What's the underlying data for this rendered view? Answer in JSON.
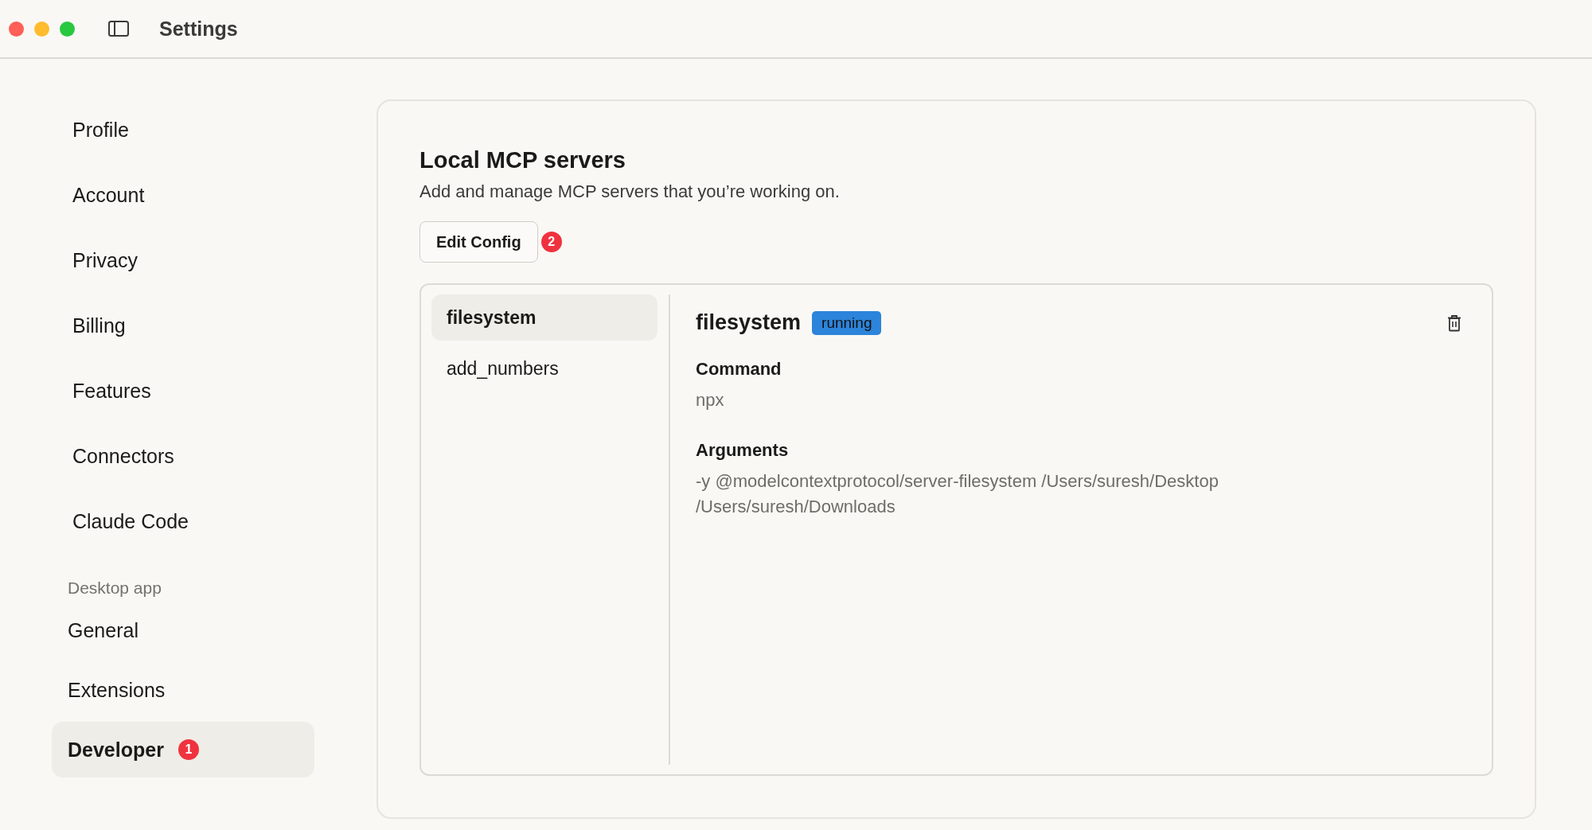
{
  "window": {
    "title": "Settings"
  },
  "sidebar": {
    "groups": [
      {
        "items": [
          {
            "label": "Profile",
            "selected": false
          },
          {
            "label": "Account",
            "selected": false
          },
          {
            "label": "Privacy",
            "selected": false
          },
          {
            "label": "Billing",
            "selected": false
          },
          {
            "label": "Features",
            "selected": false
          },
          {
            "label": "Connectors",
            "selected": false
          },
          {
            "label": "Claude Code",
            "selected": false
          }
        ]
      },
      {
        "heading": "Desktop app",
        "items": [
          {
            "label": "General",
            "selected": false
          },
          {
            "label": "Extensions",
            "selected": false
          },
          {
            "label": "Developer",
            "selected": true,
            "badge": "1"
          }
        ]
      }
    ]
  },
  "main": {
    "title": "Local MCP servers",
    "description": "Add and manage MCP servers that you’re working on.",
    "edit_button": {
      "label": "Edit Config",
      "badge": "2"
    },
    "servers": [
      {
        "name": "filesystem",
        "selected": true
      },
      {
        "name": "add_numbers",
        "selected": false
      }
    ],
    "detail": {
      "name": "filesystem",
      "status": "running",
      "fields": [
        {
          "label": "Command",
          "value": "npx"
        },
        {
          "label": "Arguments",
          "value": "-y @modelcontextprotocol/server-filesystem /Users/suresh/Desktop /Users/suresh/Downloads"
        }
      ]
    }
  }
}
